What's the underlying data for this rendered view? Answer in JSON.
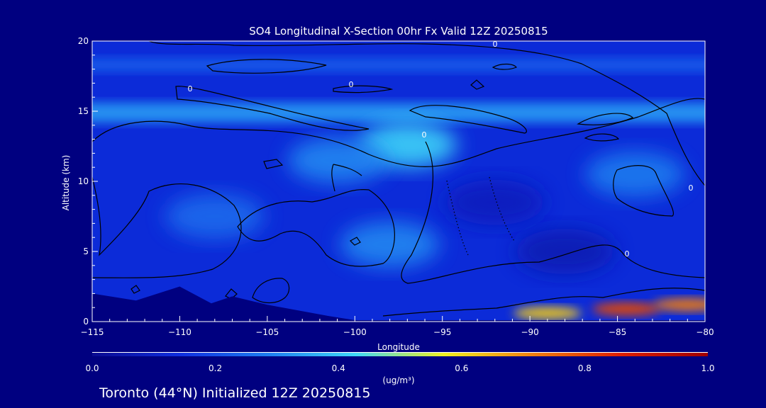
{
  "chart_data": {
    "type": "heatmap",
    "title": "SO4 Longitudinal X-Section 00hr  Fx Valid 12Z 20250815",
    "xlabel": "Longitude",
    "ylabel": "Altitude (km)",
    "xlim": [
      -115,
      -80
    ],
    "ylim": [
      0,
      20
    ],
    "x_ticks": [
      -115,
      -110,
      -105,
      -100,
      -95,
      -90,
      -85,
      -80
    ],
    "y_ticks": [
      0,
      5,
      10,
      15,
      20
    ],
    "colorbar": {
      "label": "(ug/m³)",
      "min": 0.0,
      "max": 1.0,
      "ticks": [
        "0.0",
        "0.2",
        "0.4",
        "0.6",
        "0.8",
        "1.0"
      ],
      "colormap": [
        "#0a0a90",
        "#1030e0",
        "#1e7ef0",
        "#40d8f8",
        "#f0f020",
        "#f08010",
        "#e02000",
        "#a00000"
      ]
    },
    "contour_label": "0",
    "footer": "Toronto (44°N) Initialized 12Z 20250815",
    "field_features": [
      {
        "kind": "band",
        "lon": [
          -115,
          -80
        ],
        "alt": [
          14.2,
          15.6
        ],
        "value": 0.32
      },
      {
        "kind": "band",
        "lon": [
          -115,
          -80
        ],
        "alt": [
          17.8,
          18.8
        ],
        "value": 0.22
      },
      {
        "kind": "blob",
        "lon": -97,
        "alt": 12.6,
        "value": 0.42
      },
      {
        "kind": "blob",
        "lon": -101,
        "alt": 11.5,
        "value": 0.3
      },
      {
        "kind": "blob",
        "lon": -98,
        "alt": 5.5,
        "value": 0.3
      },
      {
        "kind": "blob",
        "lon": -108,
        "alt": 7.5,
        "value": 0.25
      },
      {
        "kind": "blob",
        "lon": -88,
        "alt": 5.0,
        "value": 0.06
      },
      {
        "kind": "blob",
        "lon": -92,
        "alt": 8.5,
        "value": 0.08
      },
      {
        "kind": "blob",
        "lon": -84,
        "alt": 10.5,
        "value": 0.28
      },
      {
        "kind": "surface_peak",
        "lon": -89,
        "alt": 0.6,
        "value": 0.62
      },
      {
        "kind": "surface_peak",
        "lon": -84.5,
        "alt": 0.9,
        "value": 0.8
      },
      {
        "kind": "surface_peak",
        "lon": -81,
        "alt": 1.2,
        "value": 0.72
      }
    ],
    "terrain": [
      [
        -115,
        2.0
      ],
      [
        -112.5,
        1.5
      ],
      [
        -110,
        2.5
      ],
      [
        -108.2,
        1.3
      ],
      [
        -107,
        1.8
      ],
      [
        -105,
        1.2
      ],
      [
        -101.5,
        0.4
      ],
      [
        -100,
        0.1
      ],
      [
        -80,
        0.1
      ]
    ]
  }
}
